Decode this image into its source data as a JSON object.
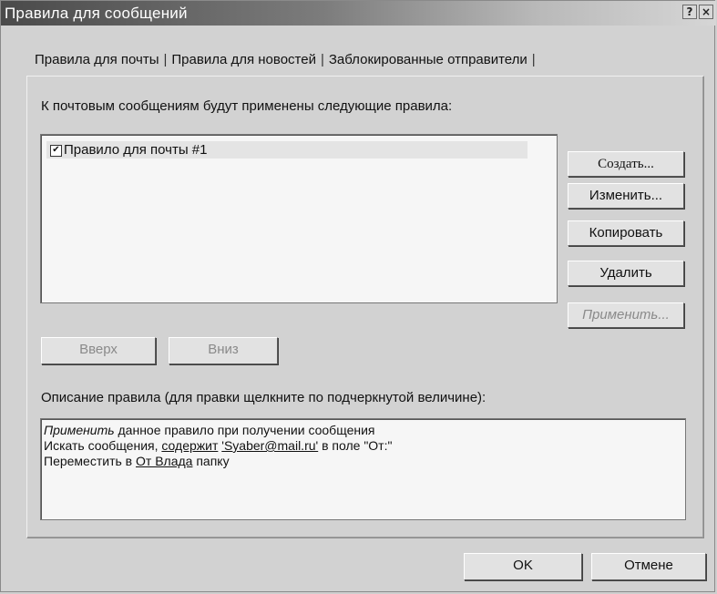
{
  "window": {
    "title": "Правила для сообщений",
    "help_label": "?",
    "close_label": "×"
  },
  "tabs": [
    {
      "label": "Правила для почты"
    },
    {
      "label": "Правила для новостей"
    },
    {
      "label": "Заблокированные отправители"
    }
  ],
  "tab_separator": "|",
  "rules_label": "К почтовым сообщениям будут применены следующие правила:",
  "rules": [
    {
      "label": "Правило для почты #1",
      "checked": true,
      "check_mark": "✔"
    }
  ],
  "buttons": {
    "create": "Создать...",
    "edit": "Изменить...",
    "copy": "Копировать",
    "delete": "Удалить",
    "apply": "Применить...",
    "up": "Вверх",
    "down": "Вниз",
    "ok": "OK",
    "cancel": "Отмене"
  },
  "description_label": "Описание правила (для правки щелкните по подчеркнутой величине):",
  "description": {
    "line1_action": "Применить",
    "line1_rest": " данное правило при получении сообщения",
    "line2_prefix": "Искать сообщения, ",
    "line2_link1": "содержит",
    "line2_space": " ",
    "line2_link2": "'Syaber@mail.ru'",
    "line2_suffix": " в поле \"От:\"",
    "line3_prefix": "Переместить в ",
    "line3_link": "От Влада",
    "line3_suffix": " папку"
  }
}
